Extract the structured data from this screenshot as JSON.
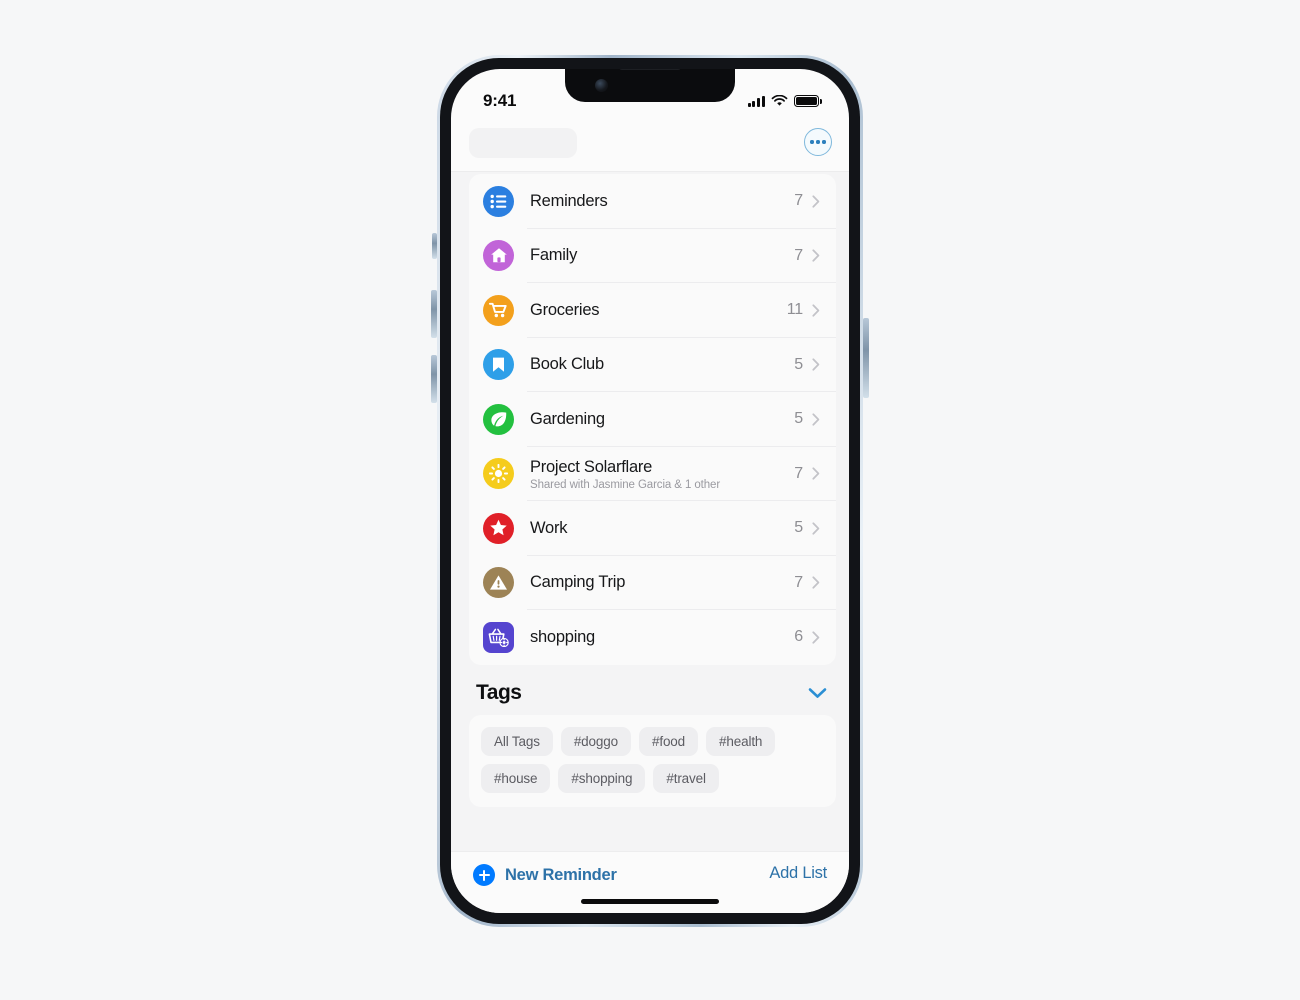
{
  "device": {
    "frame": "iphone",
    "home_indicator": true
  },
  "status_bar": {
    "time": "9:41",
    "signal_icon": "cellular-bars-icon",
    "wifi_icon": "wifi-icon",
    "battery_icon": "battery-full-icon"
  },
  "nav": {
    "more_button": {
      "icon": "ellipsis-circle-icon",
      "label": "More"
    }
  },
  "lists": [
    {
      "name": "Reminders",
      "count": "7",
      "icon": "list-bullet-icon",
      "color": "#2b7fe0",
      "shape": "circle",
      "subtitle": ""
    },
    {
      "name": "Family",
      "count": "7",
      "icon": "house-icon",
      "color": "#c164d8",
      "shape": "circle",
      "subtitle": ""
    },
    {
      "name": "Groceries",
      "count": "11",
      "icon": "shopping-cart-icon",
      "color": "#f3a01c",
      "shape": "circle",
      "subtitle": ""
    },
    {
      "name": "Book Club",
      "count": "5",
      "icon": "bookmark-icon",
      "color": "#2e9fe8",
      "shape": "circle",
      "subtitle": ""
    },
    {
      "name": "Gardening",
      "count": "5",
      "icon": "leaf-icon",
      "color": "#23c03f",
      "shape": "circle",
      "subtitle": ""
    },
    {
      "name": "Project Solarflare",
      "count": "7",
      "icon": "sun-icon",
      "color": "#f5cc1c",
      "shape": "circle",
      "subtitle": "Shared with Jasmine Garcia & 1 other"
    },
    {
      "name": "Work",
      "count": "5",
      "icon": "star-icon",
      "color": "#e02028",
      "shape": "circle",
      "subtitle": ""
    },
    {
      "name": "Camping Trip",
      "count": "7",
      "icon": "tent-icon",
      "color": "#9d8356",
      "shape": "circle",
      "subtitle": ""
    },
    {
      "name": "shopping",
      "count": "6",
      "icon": "basket-gear-icon",
      "color": "#5544cf",
      "shape": "square",
      "subtitle": ""
    }
  ],
  "tags_section": {
    "title": "Tags",
    "collapse_icon": "chevron-down-icon",
    "chips": [
      "All Tags",
      "#doggo",
      "#food",
      "#health",
      "#house",
      "#shopping",
      "#travel"
    ]
  },
  "toolbar": {
    "new_reminder_label": "New Reminder",
    "new_reminder_icon": "plus-circle-icon",
    "add_list_label": "Add List"
  },
  "theme": {
    "accent": "#007aff",
    "link": "#2d72a8",
    "page_bg": "#f6f7f8",
    "card_bg": "#fafafa",
    "chip_bg": "#eeeef0"
  }
}
